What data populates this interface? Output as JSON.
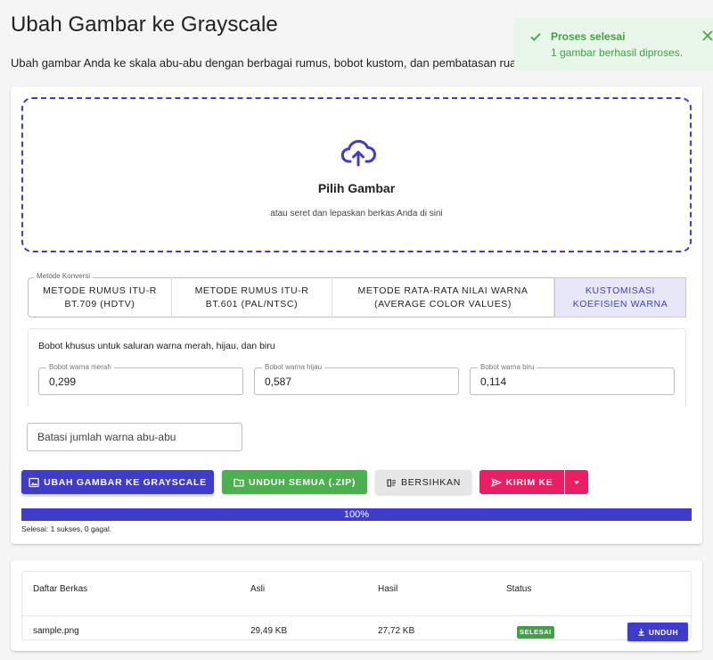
{
  "page": {
    "title": "Ubah Gambar ke Grayscale",
    "description": "Ubah gambar Anda ke skala abu-abu dengan berbagai rumus, bobot kustom, dan pembatasan ruang"
  },
  "toast": {
    "title": "Proses selesai",
    "message": "1 gambar berhasil diproses.",
    "color": "#43a047"
  },
  "dropzone": {
    "icon": "cloud-upload-icon",
    "title": "Pilih Gambar",
    "hint": "atau seret dan lepaskan berkas Anda di sini"
  },
  "method": {
    "legend": "Metode Konversi",
    "options": [
      {
        "line1": "METODE RUMUS ITU-R",
        "line2": "BT.709 (HDTV)"
      },
      {
        "line1": "METODE RUMUS ITU-R",
        "line2": "BT.601 (PAL/NTSC)"
      },
      {
        "line1": "METODE RATA-RATA NILAI WARNA",
        "line2": "(AVERAGE COLOR VALUES)"
      },
      {
        "line1": "KUSTOMISASI",
        "line2": "KOEFISIEN WARNA"
      }
    ],
    "selected": 3
  },
  "weights": {
    "title": "Bobot khusus untuk saluran warna merah, hijau, dan biru",
    "red": {
      "label": "Bobot warna merah",
      "value": "0,299"
    },
    "green": {
      "label": "Bobot warna hijau",
      "value": "0,587"
    },
    "blue": {
      "label": "Bobot warna biru",
      "value": "0,114"
    }
  },
  "limit": {
    "placeholder": "Batasi jumlah warna abu-abu"
  },
  "actions": {
    "convert": "UBAH GAMBAR KE GRAYSCALE",
    "zip": "UNDUH SEMUA (.ZIP)",
    "clear": "BERSIHKAN",
    "send": "KIRIM KE"
  },
  "progress": {
    "percent": 100,
    "text": "100%",
    "summary": "Selesai: 1 sukses, 0 gagal."
  },
  "files": {
    "headers": {
      "name": "Daftar Berkas",
      "original": "Asli",
      "result": "Hasil",
      "status": "Status"
    },
    "rows": [
      {
        "name": "sample.png",
        "original": "29,49 KB",
        "result": "27,72 KB",
        "status": "SELESAI",
        "action": "UNDUH"
      }
    ]
  },
  "colors": {
    "primary": "#3f3dc8",
    "success": "#4caf50",
    "send": "#e91e63"
  }
}
